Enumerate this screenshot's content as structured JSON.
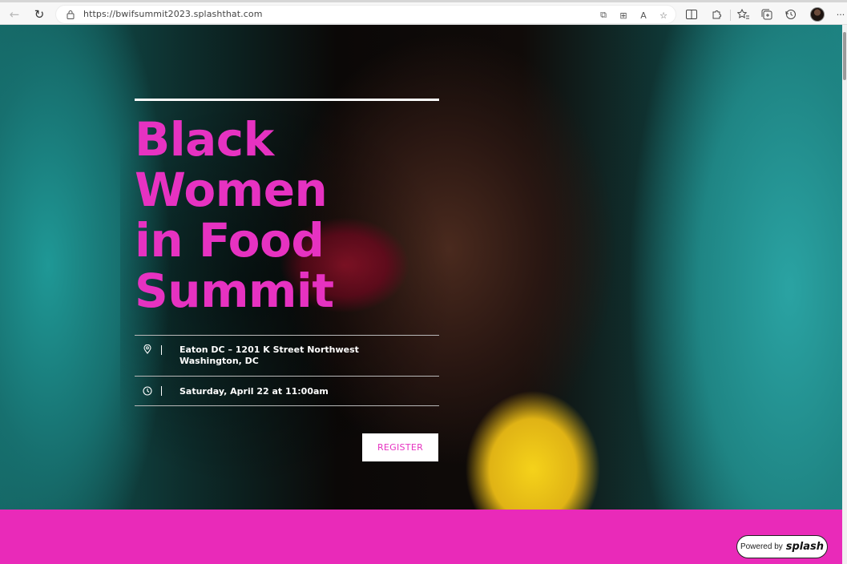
{
  "browser": {
    "url": "https://bwifsummit2023.splashthat.com",
    "nav": {
      "back_icon": "←",
      "reload_icon": "↻"
    },
    "address_icons": [
      "⧉",
      "⊞",
      "A",
      "☆"
    ],
    "more_label": "···"
  },
  "hero": {
    "title_lines": [
      "Black",
      "Women",
      "in Food",
      "Summit"
    ],
    "location": "Eaton DC – 1201 K Street Northwest Washington, DC",
    "datetime": "Saturday, April 22 at 11:00am",
    "register_label": "REGISTER",
    "accent_color": "#e632c1"
  },
  "footer": {
    "powered_by": "Powered by",
    "brand": "splash",
    "band_color": "#e92ab9"
  }
}
